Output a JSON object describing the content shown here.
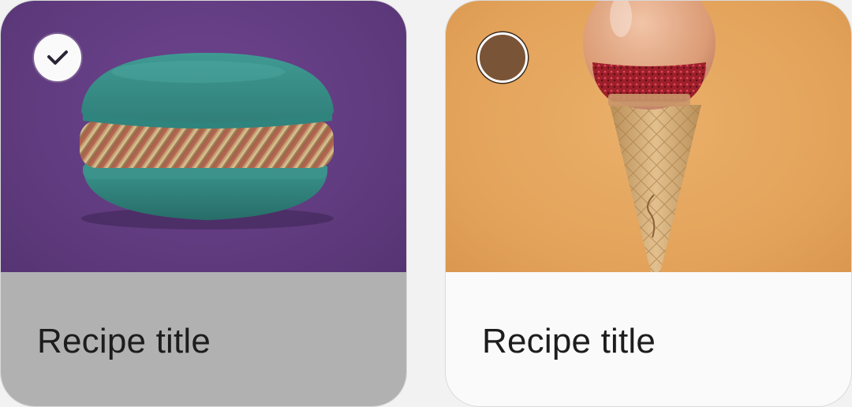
{
  "cards": [
    {
      "title": "Recipe title",
      "selected": true,
      "image_icon": "macaron-image"
    },
    {
      "title": "Recipe title",
      "selected": false,
      "image_icon": "ice-cream-cone-image"
    }
  ],
  "colors": {
    "selected_title_bg": "#b1b1b1",
    "unselected_title_bg": "#fafafa",
    "left_image_bg": "#5e3a7c",
    "right_image_bg": "#e3a25a",
    "unselected_indicator": "#7a5436"
  }
}
